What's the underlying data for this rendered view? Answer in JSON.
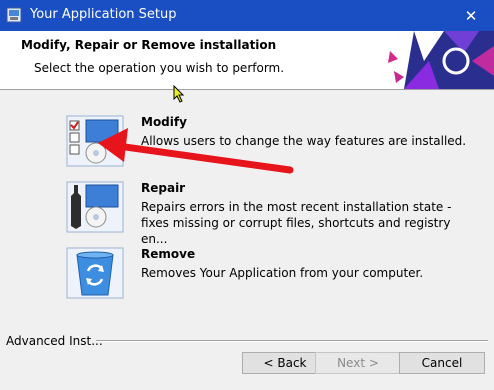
{
  "window": {
    "title": "Your Application Setup",
    "close_glyph": "✕"
  },
  "header": {
    "title": "Modify, Repair or Remove installation",
    "subtitle": "Select the operation you wish to perform."
  },
  "options": [
    {
      "label": "Modify",
      "description": "Allows users to change the way features are installed.",
      "icon": "modify-icon"
    },
    {
      "label": "Repair",
      "description": "Repairs errors in the most recent installation state -\nfixes missing or corrupt files, shortcuts and registry en...",
      "icon": "repair-icon"
    },
    {
      "label": "Remove",
      "description": "Removes Your Application from your computer.",
      "icon": "recycle-bin-icon"
    }
  ],
  "footer": {
    "brand": "Advanced Inst...",
    "back_label": "< Back",
    "next_label": "Next >",
    "cancel_label": "Cancel"
  },
  "colors": {
    "titlebar": "#1a4fc4",
    "annotation_arrow": "#e8141c",
    "accent": "#2b5db8"
  }
}
